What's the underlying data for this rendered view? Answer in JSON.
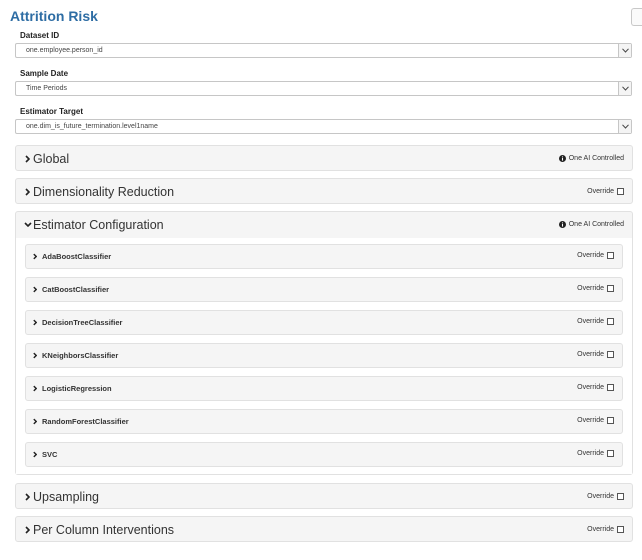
{
  "header": {
    "title": "Attrition Risk"
  },
  "fields": [
    {
      "label": "Dataset ID",
      "value": "one.employee.person_id"
    },
    {
      "label": "Sample Date",
      "value": "Time Periods"
    },
    {
      "label": "Estimator Target",
      "value": "one.dim_is_future_termination.level1name"
    }
  ],
  "sections": {
    "global": {
      "title": "Global",
      "status": "One AI Controlled"
    },
    "dimensionality": {
      "title": "Dimensionality Reduction",
      "override_label": "Override"
    },
    "estimator": {
      "title": "Estimator Configuration",
      "status": "One AI Controlled",
      "items": [
        {
          "label": "AdaBoostClassifier",
          "override_label": "Override"
        },
        {
          "label": "CatBoostClassifier",
          "override_label": "Override"
        },
        {
          "label": "DecisionTreeClassifier",
          "override_label": "Override"
        },
        {
          "label": "KNeighborsClassifier",
          "override_label": "Override"
        },
        {
          "label": "LogisticRegression",
          "override_label": "Override"
        },
        {
          "label": "RandomForestClassifier",
          "override_label": "Override"
        },
        {
          "label": "SVC",
          "override_label": "Override"
        }
      ]
    },
    "upsampling": {
      "title": "Upsampling",
      "override_label": "Override"
    },
    "per_column": {
      "title": "Per Column Interventions",
      "override_label": "Override"
    }
  },
  "icons": {
    "collapsed": "chevron-right-icon",
    "expanded": "chevron-down-icon",
    "info": "info-circle-icon",
    "dropdown": "caret-down-icon"
  }
}
